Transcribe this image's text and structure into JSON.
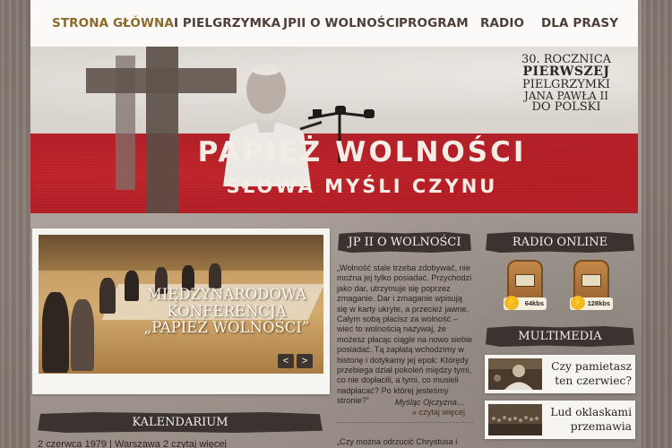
{
  "nav": {
    "items": [
      "STRONA GŁÓWNA",
      "I PIELGRZYMKA",
      "JPII O WOLNOŚCI",
      "PROGRAM",
      "RADIO",
      "DLA PRASY"
    ]
  },
  "banner": {
    "tagline": [
      "30. ROCZNICA",
      "PIERWSZEJ",
      "PIELGRZYMKI",
      "JANA PAWŁA II",
      "DO POLSKI"
    ],
    "title": "PAPIEŻ WOLNOŚCI",
    "subtitle": "SŁOWA MYŚLI CZYNU"
  },
  "slider": {
    "caption_1": "MIĘDZYNARODOWA",
    "caption_2": "KONFERENCJA",
    "caption_3": "„PAPIEŻ WOLNOŚCI”",
    "prev": "<",
    "next": ">"
  },
  "calendar": {
    "title": "KALENDARIUM",
    "first_entry": "2 czerwca 1979 | Warszawa 2 czytaj więcej"
  },
  "quote": {
    "title": "JP II O WOLNOŚCI",
    "text": "„Wolność stale trzeba zdobywać, nie można jej tylko posiadać. Przychodzi jako dar, utrzymuje się poprzez zmaganie. Dar i zmaganie wpisują się w karty ukryte, a przecież jawne. Całym sobą płacisz za wolność – wiec to wolnością nazywaj, że możesz płacąc ciągle na nowo siebie posiadać. Tą zapłatą wchodzimy w historię i dotykamy jej epok: Którędy przebiega dział pokoleń między tymi, co nie dopłacili, a tymi, co musieli nadpłacać? Po której jesteśmy stronie?”",
    "signature": "Myśląc Ojczyzna…",
    "link": "» czytaj więcej",
    "next_text": "„Czy można odrzucić Chrystusa i"
  },
  "radio": {
    "title": "RADIO ONLINE",
    "streams": [
      "64kbs",
      "128kbs"
    ]
  },
  "multimedia": {
    "title": "MULTIMEDIA",
    "items": [
      {
        "title_1": "Czy pamietasz",
        "title_2": "ten czerwiec?"
      },
      {
        "title_1": "Lud oklaskami",
        "title_2": "przemawia"
      }
    ]
  },
  "colors": {
    "nav_active": "#8b6a2a",
    "nav_text": "#4d3f37",
    "banner_red": "#b7212a",
    "heading_bar": "#3a3330",
    "page_bg": "#a59a92"
  }
}
